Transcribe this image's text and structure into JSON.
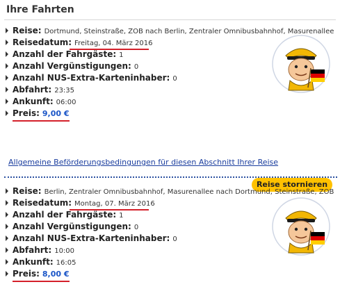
{
  "page": {
    "title": "Ihre Fahrten"
  },
  "trips": [
    {
      "reise_label": "Reise:",
      "reise_value": "Dortmund, Steinstraße, ZOB nach Berlin, Zentraler Omnibusbahnhof, Masurenallee",
      "datum_label": "Reisedatum:",
      "datum_value": "Freitag, 04. März 2016",
      "gaeste_label": "Anzahl der Fahrgäste:",
      "gaeste_value": "1",
      "verg_label": "Anzahl Vergünstigungen:",
      "verg_value": "0",
      "nus_label": "Anzahl NUS-Extra-Karteninhaber:",
      "nus_value": "0",
      "abfahrt_label": "Abfahrt:",
      "abfahrt_value": "23:35",
      "ankunft_label": "Ankunft:",
      "ankunft_value": "06:00",
      "preis_label": "Preis:",
      "preis_value": "9,00 €",
      "terms_link": "Allgemeine Beförderungsbedingungen für diesen Abschnitt Ihrer Reise",
      "cancel_button": "Reise stornieren"
    },
    {
      "reise_label": "Reise:",
      "reise_value": "Berlin, Zentraler Omnibusbahnhof, Masurenallee nach Dortmund, Steinstraße, ZOB",
      "datum_label": "Reisedatum:",
      "datum_value": "Montag, 07. März 2016",
      "gaeste_label": "Anzahl der Fahrgäste:",
      "gaeste_value": "1",
      "verg_label": "Anzahl Vergünstigungen:",
      "verg_value": "0",
      "nus_label": "Anzahl NUS-Extra-Karteninhaber:",
      "nus_value": "0",
      "abfahrt_label": "Abfahrt:",
      "abfahrt_value": "10:00",
      "ankunft_label": "Ankunft:",
      "ankunft_value": "16:05",
      "preis_label": "Preis:",
      "preis_value": "8,00 €"
    }
  ],
  "mascot": {
    "icon": "bus-driver-mascot-icon",
    "flag_colors": [
      "#000000",
      "#dd0000",
      "#ffce00"
    ]
  },
  "colors": {
    "accent_yellow": "#ffc100",
    "link_blue": "#1a3d9e",
    "price_blue": "#1a55c7",
    "highlight_red": "#d4202a"
  }
}
